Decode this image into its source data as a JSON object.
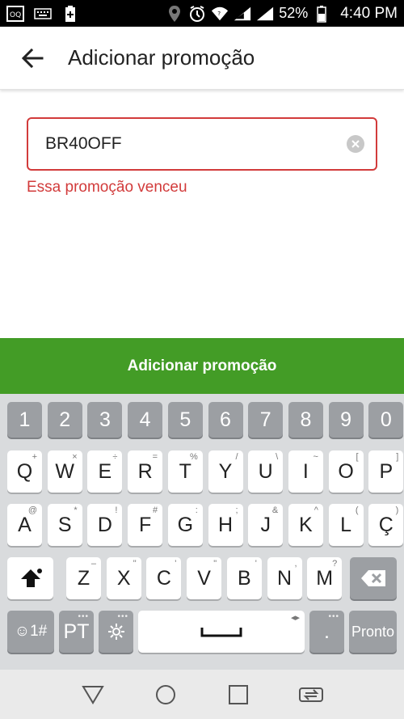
{
  "status_bar": {
    "battery_percent": "52%",
    "time": "4:40 PM",
    "icons": [
      "notification-icon",
      "keyboard-icon",
      "battery-saver-icon",
      "location-icon",
      "alarm-icon",
      "wifi-icon",
      "signal-icon",
      "signal-icon-2",
      "battery-icon"
    ]
  },
  "header": {
    "back_icon": "arrow-left-icon",
    "title": "Adicionar promoção"
  },
  "promo": {
    "value": "BR40OFF",
    "error": "Essa promoção venceu",
    "border_color": "#d23b3b"
  },
  "primary_button": {
    "label": "Adicionar promoção",
    "color": "#439c26"
  },
  "keyboard": {
    "number_row": [
      "1",
      "2",
      "3",
      "4",
      "5",
      "6",
      "7",
      "8",
      "9",
      "0"
    ],
    "row1": [
      {
        "key": "Q",
        "sub": "+"
      },
      {
        "key": "W",
        "sub": "×"
      },
      {
        "key": "E",
        "sub": "÷"
      },
      {
        "key": "R",
        "sub": "="
      },
      {
        "key": "T",
        "sub": "%"
      },
      {
        "key": "Y",
        "sub": "/"
      },
      {
        "key": "U",
        "sub": "\\"
      },
      {
        "key": "I",
        "sub": "~"
      },
      {
        "key": "O",
        "sub": "["
      },
      {
        "key": "P",
        "sub": "]"
      }
    ],
    "row2": [
      {
        "key": "A",
        "sub": "@"
      },
      {
        "key": "S",
        "sub": "*"
      },
      {
        "key": "D",
        "sub": "!"
      },
      {
        "key": "F",
        "sub": "#"
      },
      {
        "key": "G",
        "sub": ":"
      },
      {
        "key": "H",
        "sub": ";"
      },
      {
        "key": "J",
        "sub": "&"
      },
      {
        "key": "K",
        "sub": "^"
      },
      {
        "key": "L",
        "sub": "("
      },
      {
        "key": "Ç",
        "sub": ")"
      }
    ],
    "row3": [
      {
        "key": "Z",
        "sub": "–"
      },
      {
        "key": "X",
        "sub": "\""
      },
      {
        "key": "C",
        "sub": "'"
      },
      {
        "key": "V",
        "sub": "\""
      },
      {
        "key": "B",
        "sub": "'"
      },
      {
        "key": "N",
        "sub": ","
      },
      {
        "key": "M",
        "sub": "?"
      }
    ],
    "symbols_label": "☺1#",
    "language_label": "PT",
    "done_label": "Pronto",
    "period_label": ".",
    "settings_icon": "gear-icon",
    "shift_icon": "shift-icon",
    "backspace_icon": "backspace-icon",
    "space_icon": "space-bar-icon"
  },
  "nav_bar": {
    "back_icon": "triangle-back-icon",
    "home_icon": "circle-home-icon",
    "recents_icon": "square-recents-icon",
    "switch_icon": "switch-apps-icon"
  }
}
